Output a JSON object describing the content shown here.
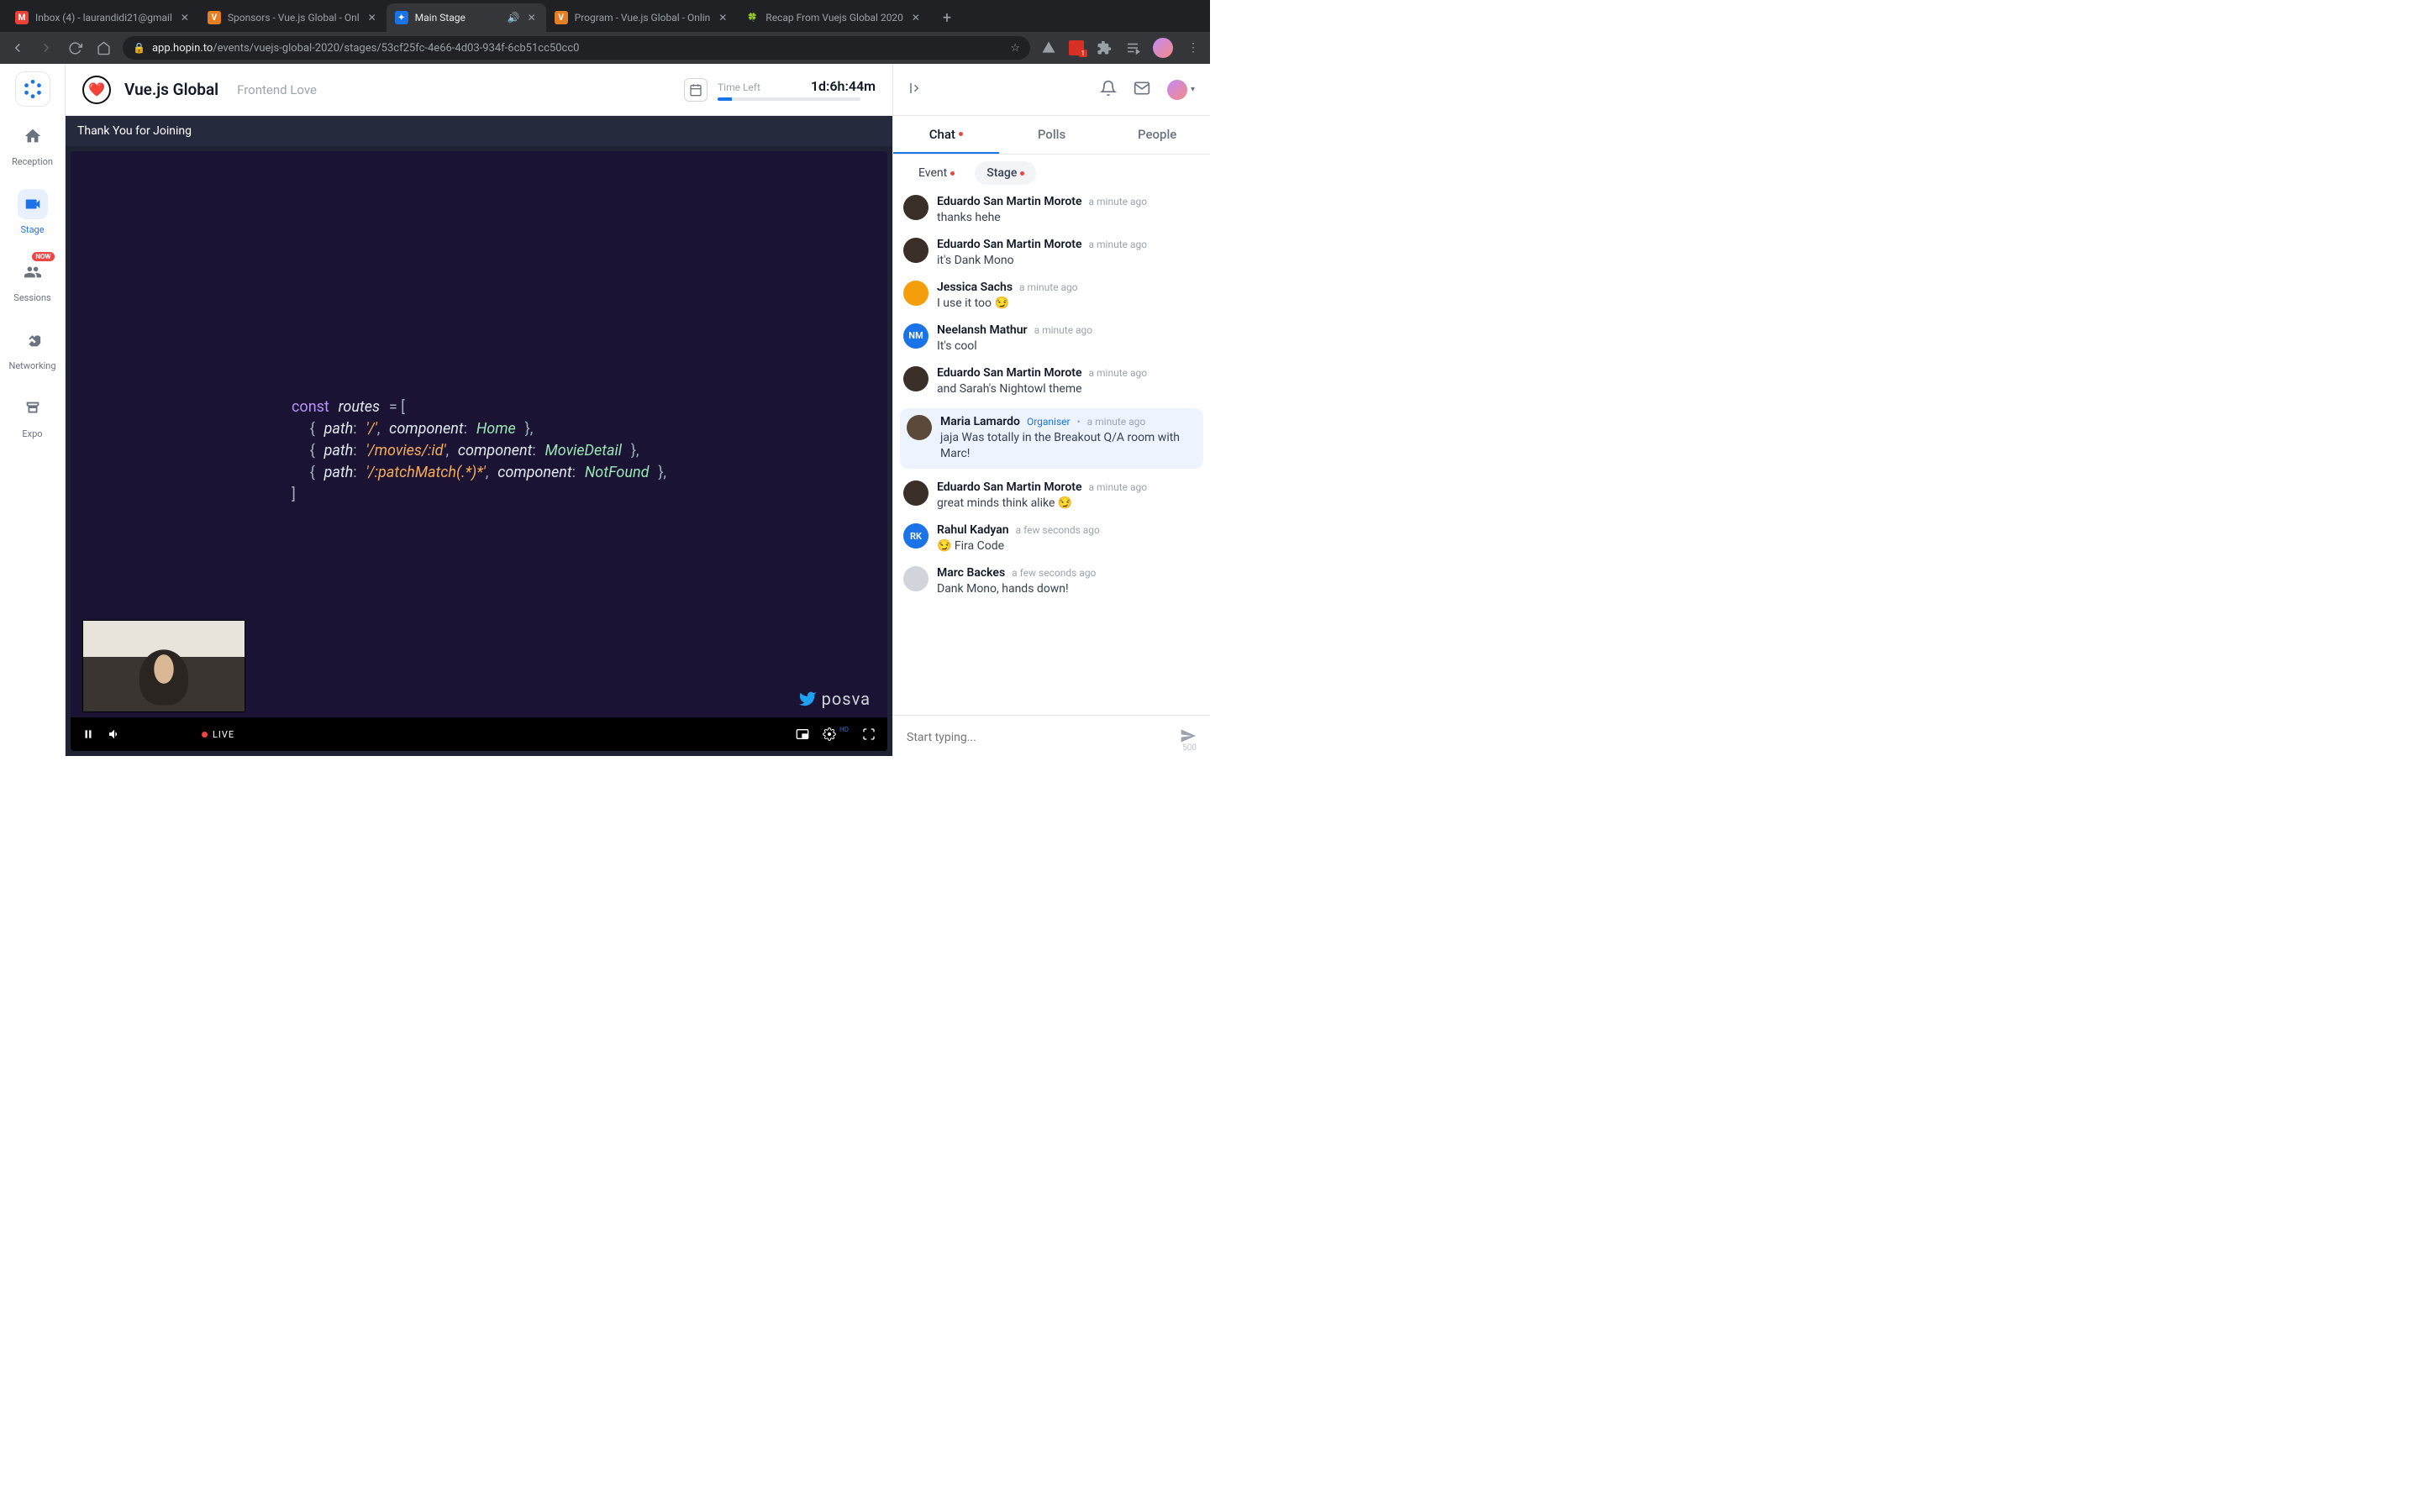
{
  "browser": {
    "tabs": [
      {
        "title": "Inbox (4) - laurandidi21@gmail",
        "icon": "M",
        "iconBg": "#ea4335",
        "active": false
      },
      {
        "title": "Sponsors - Vue.js Global - Onl",
        "icon": "V",
        "iconBg": "#e67e22",
        "active": false
      },
      {
        "title": "Main Stage",
        "icon": "✦",
        "iconBg": "#1a73e8",
        "active": true,
        "audio": true
      },
      {
        "title": "Program - Vue.js Global - Onlin",
        "icon": "V",
        "iconBg": "#e67e22",
        "active": false
      },
      {
        "title": "Recap From Vuejs Global 2020",
        "icon": "🍀",
        "iconBg": "transparent",
        "active": false
      }
    ],
    "url_host": "app.hopin.to",
    "url_path": "/events/vuejs-global-2020/stages/53cf25fc-4e66-4d03-934f-6cb51cc50cc0",
    "ext_badge": "1"
  },
  "event": {
    "title": "Vue.js Global",
    "subtitle": "Frontend Love",
    "time_label": "Time Left",
    "time_value": "1d:6h:44m"
  },
  "rail": {
    "items": [
      {
        "label": "Reception"
      },
      {
        "label": "Stage"
      },
      {
        "label": "Sessions",
        "badge": "NOW"
      },
      {
        "label": "Networking"
      },
      {
        "label": "Expo"
      }
    ]
  },
  "stage": {
    "header": "Thank You for Joining",
    "live": "LIVE",
    "handle": "posva",
    "code": "const routes = [\n  { path: '/', component: Home },\n  { path: '/movies/:id', component: MovieDetail },\n  { path: '/:patchMatch(.*)*', component: NotFound },\n]"
  },
  "chat": {
    "tabs": {
      "chat": "Chat",
      "polls": "Polls",
      "people": "People"
    },
    "sub": {
      "event": "Event",
      "stage": "Stage"
    },
    "placeholder": "Start typing...",
    "char_limit": "500",
    "organiser_label": "Organiser",
    "messages": [
      {
        "name": "Eduardo San Martin Morote",
        "time": "a minute ago",
        "text": "thanks hehe",
        "avBg": "#3a2e28",
        "avTxt": ""
      },
      {
        "name": "Eduardo San Martin Morote",
        "time": "a minute ago",
        "text": "it's Dank Mono",
        "avBg": "#3a2e28",
        "avTxt": ""
      },
      {
        "name": "Jessica Sachs",
        "time": "a minute ago",
        "text": "I use it too 😏",
        "avBg": "#f59e0b",
        "avTxt": ""
      },
      {
        "name": "Neelansh Mathur",
        "time": "a minute ago",
        "text": "It's cool",
        "avBg": "#1a73e8",
        "avTxt": "NM"
      },
      {
        "name": "Eduardo San Martin Morote",
        "time": "a minute ago",
        "text": "and Sarah's Nightowl theme",
        "avBg": "#3a2e28",
        "avTxt": ""
      },
      {
        "name": "Maria Lamardo",
        "time": "a minute ago",
        "text": "jaja Was totally in the Breakout Q/A room with Marc!",
        "avBg": "#5b4a3a",
        "avTxt": "",
        "organiser": true,
        "highlight": true
      },
      {
        "name": "Eduardo San Martin Morote",
        "time": "a minute ago",
        "text": "great minds think alike 😏",
        "avBg": "#3a2e28",
        "avTxt": ""
      },
      {
        "name": "Rahul Kadyan",
        "time": "a few seconds ago",
        "text": "😏 Fira Code",
        "avBg": "#1a73e8",
        "avTxt": "RK"
      },
      {
        "name": "Marc Backes",
        "time": "a few seconds ago",
        "text": "Dank Mono, hands down!",
        "avBg": "#d1d5db",
        "avTxt": ""
      }
    ]
  }
}
